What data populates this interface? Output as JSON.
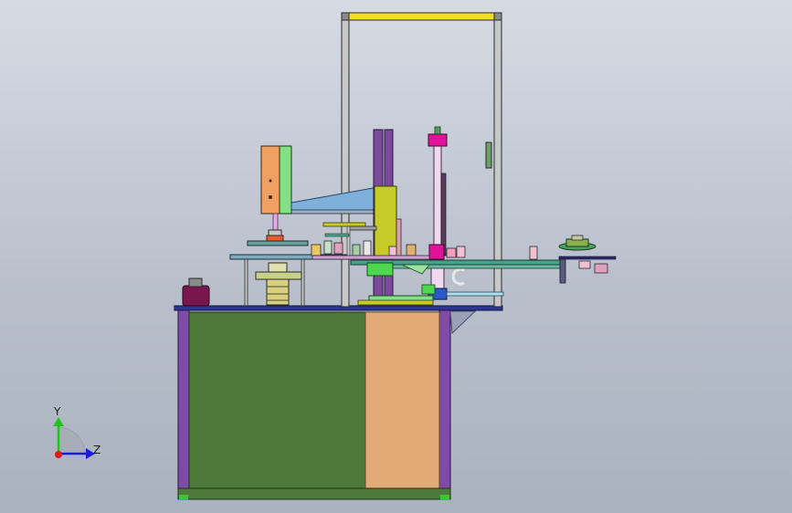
{
  "triad": {
    "y_label": "Y",
    "z_label": "Z",
    "y_color": "#1fc21f",
    "z_color": "#1a1ae0",
    "x_color": "#e01a1a"
  },
  "colors": {
    "frame_gray": "#c8c8c8",
    "top_beam": "#f2e01c",
    "cabinet_panel": "#4d7a38",
    "cabinet_door": "#e2aa76",
    "cabinet_leg": "#7f4aa8",
    "table_top": "#2b3594",
    "column_purple": "#7b4a9b",
    "olive": "#c7cb2a",
    "teal_rail": "#4aa08a",
    "magenta": "#e0129a",
    "cyan_blade": "#7fb0dc",
    "orange_panel": "#f0a060",
    "lime_panel": "#84e084",
    "maroon_block": "#7a1550"
  }
}
